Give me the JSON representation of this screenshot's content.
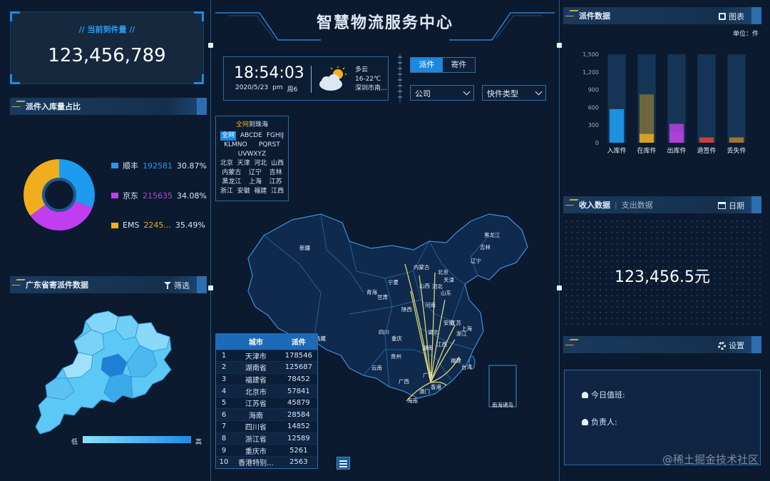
{
  "title": "智慧物流服务中心",
  "kpi": {
    "label": "当前到件量",
    "value": "123,456,789"
  },
  "clock": {
    "time": "18:54:03",
    "date": "2020/5/23",
    "ampm": "pm",
    "weekday": "周6"
  },
  "weather": {
    "desc": "多云",
    "temp": "16-22℃",
    "city": "深圳市南..."
  },
  "toggle": {
    "left": "派件",
    "right": "寄件"
  },
  "filters": {
    "company": "公司",
    "type": "快件类型"
  },
  "share_panel": {
    "title": "派件入库量占比",
    "items": [
      {
        "name": "顺丰",
        "value": "192581",
        "pct": "30.87%",
        "color": "#1e9bf0"
      },
      {
        "name": "京东",
        "value": "215635",
        "pct": "34.08%",
        "color": "#c13ef0"
      },
      {
        "name": "EMS",
        "value": "2245...",
        "pct": "35.49%",
        "color": "#f0ad1e"
      }
    ],
    "fractions": [
      0.3087,
      0.3408,
      0.3549
    ]
  },
  "guangdong": {
    "title": "广东省寄派件数据",
    "filter_label": "筛选",
    "legend_low": "低",
    "legend_high": "高"
  },
  "region_selector": {
    "title_prefix": "全网",
    "title_suffix": "到珠海",
    "line1": [
      "全网",
      "ABCDE",
      "FGHIJ"
    ],
    "line2": [
      "KLMNO",
      "PQRST"
    ],
    "line3": [
      "UVWXYZ"
    ],
    "line4": [
      "北京",
      "天津",
      "河北",
      "山西"
    ],
    "line5": [
      "内蒙古",
      "辽宁",
      "吉林"
    ],
    "line6": [
      "黑龙江",
      "上海",
      "江苏"
    ],
    "line7": [
      "浙江",
      "安徽",
      "福建",
      "江西"
    ]
  },
  "map": {
    "labels": [
      "新疆",
      "西藏",
      "青海",
      "甘肃",
      "宁夏",
      "内蒙古",
      "黑龙江",
      "吉林",
      "辽宁",
      "北京",
      "天津",
      "河北",
      "山西",
      "山东",
      "陕西",
      "河南",
      "四川",
      "重庆",
      "湖北",
      "安徽",
      "江苏",
      "上海",
      "浙江",
      "湖南",
      "江西",
      "福建",
      "贵州",
      "云南",
      "广西",
      "广东",
      "台湾",
      "香港",
      "澳门",
      "海南",
      "南海诸岛"
    ]
  },
  "rank_table": {
    "headers": [
      "城市",
      "派件"
    ],
    "rows": [
      [
        "1",
        "天津市",
        "178546"
      ],
      [
        "2",
        "湖南省",
        "125687"
      ],
      [
        "3",
        "福建省",
        "78452"
      ],
      [
        "4",
        "北京市",
        "57841"
      ],
      [
        "5",
        "江苏省",
        "45879"
      ],
      [
        "6",
        "海南",
        "28584"
      ],
      [
        "7",
        "四川省",
        "14852"
      ],
      [
        "8",
        "浙江省",
        "12589"
      ],
      [
        "9",
        "重庆市",
        "5261"
      ],
      [
        "10",
        "香港特别...",
        "2563"
      ]
    ]
  },
  "dispatch": {
    "title": "派件数据",
    "view_label": "图表",
    "unit": "单位：件",
    "chart_data": {
      "type": "bar",
      "categories": [
        "入库件",
        "在库件",
        "出库件",
        "退签件",
        "丢失件"
      ],
      "values": [
        570,
        820,
        320,
        90,
        90
      ],
      "series": [
        {
          "name": "",
          "values": [
            570,
            820,
            320,
            90,
            90
          ]
        }
      ],
      "secondary": [
        0,
        150,
        180,
        0,
        0
      ],
      "ylim": [
        0,
        1500
      ],
      "yticks": [
        "0",
        "300",
        "600",
        "900",
        "1,200",
        "1,500"
      ],
      "colors": [
        "#1e9bf0",
        "#d6a11e",
        "#b13fd8",
        "#d9423e",
        "#b07b2a"
      ]
    }
  },
  "income": {
    "tab_active": "收入数据",
    "tab_inactive": "支出数据",
    "date_label": "日期",
    "value": "123,456.5元"
  },
  "settings": {
    "label": "设置",
    "duty_label": "今日值班:",
    "owner_label": "负责人:"
  },
  "watermark": "@稀土掘金技术社区"
}
